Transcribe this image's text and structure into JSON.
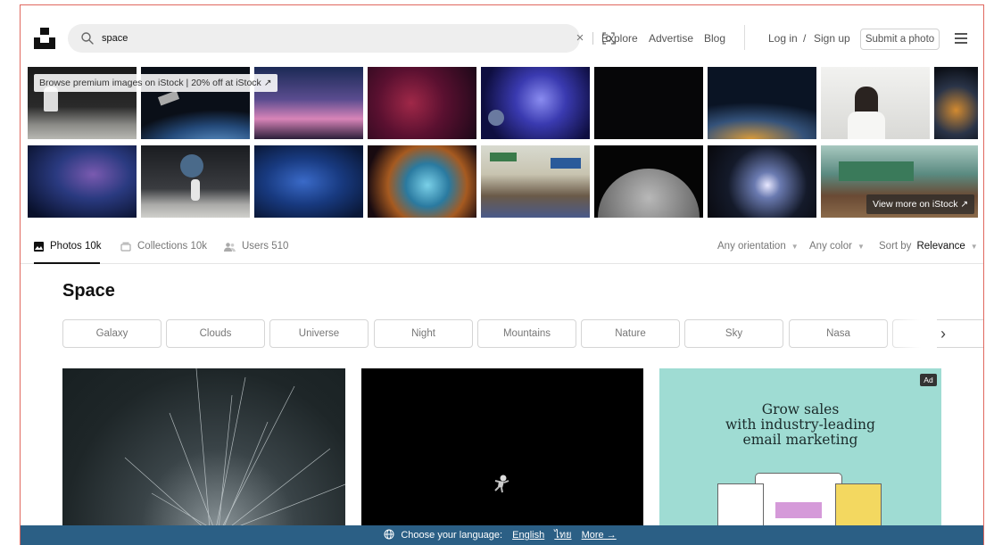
{
  "header": {
    "search_value": "space",
    "nav": [
      "Explore",
      "Advertise",
      "Blog"
    ],
    "login": "Log in",
    "slash": "/",
    "signup": "Sign up",
    "submit": "Submit a photo"
  },
  "istock": {
    "badge": "Browse premium images on iStock | 20% off at iStock ↗",
    "view_more": "View more on iStock ↗"
  },
  "tabs": [
    {
      "label": "Photos 10k"
    },
    {
      "label": "Collections 10k"
    },
    {
      "label": "Users 510"
    }
  ],
  "filters": {
    "orientation": "Any orientation",
    "color": "Any color",
    "sort_prefix": "Sort by",
    "sort_value": "Relevance"
  },
  "page_title": "Space",
  "chips": [
    "Galaxy",
    "Clouds",
    "Universe",
    "Night",
    "Mountains",
    "Nature",
    "Sky",
    "Nasa"
  ],
  "ad": {
    "tag": "Ad",
    "line1": "Grow sales",
    "line2": "with industry-leading",
    "line3": "email marketing"
  },
  "langbar": {
    "prefix": "Choose your language:",
    "english": "English",
    "thai": "ไทย",
    "more": "More →"
  },
  "colors": {
    "accent_border": "#e0685f",
    "langbar_bg": "#2b5f85",
    "ad_bg": "#9fdcd3"
  }
}
